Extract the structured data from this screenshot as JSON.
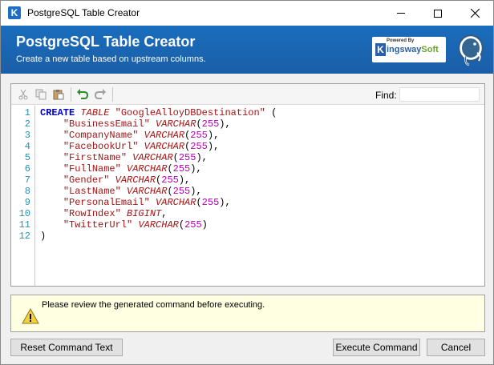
{
  "window": {
    "title": "PostgreSQL Table Creator"
  },
  "banner": {
    "title": "PostgreSQL Table Creator",
    "subtitle": "Create a new table based on upstream columns.",
    "logo_powered": "Powered By",
    "logo_k": "K",
    "logo_name_a": "ingsway",
    "logo_name_b": "Soft"
  },
  "toolbar": {
    "find_label": "Find:",
    "find_value": "",
    "icons": [
      "cut-icon",
      "copy-icon",
      "paste-icon",
      "undo-icon",
      "redo-icon"
    ]
  },
  "editor": {
    "line_numbers": [
      "1",
      "2",
      "3",
      "4",
      "5",
      "6",
      "7",
      "8",
      "9",
      "10",
      "11",
      "12"
    ],
    "create_kw": "CREATE",
    "table_kw": "TABLE",
    "table_name": "\"GoogleAlloyDBDestination\"",
    "open_paren": " (",
    "columns": [
      {
        "name": "\"BusinessEmail\"",
        "type": "VARCHAR",
        "len": "255",
        "trail": "),"
      },
      {
        "name": "\"CompanyName\"",
        "type": "VARCHAR",
        "len": "255",
        "trail": "),"
      },
      {
        "name": "\"FacebookUrl\"",
        "type": "VARCHAR",
        "len": "255",
        "trail": "),"
      },
      {
        "name": "\"FirstName\"",
        "type": "VARCHAR",
        "len": "255",
        "trail": "),"
      },
      {
        "name": "\"FullName\"",
        "type": "VARCHAR",
        "len": "255",
        "trail": "),"
      },
      {
        "name": "\"Gender\"",
        "type": "VARCHAR",
        "len": "255",
        "trail": "),"
      },
      {
        "name": "\"LastName\"",
        "type": "VARCHAR",
        "len": "255",
        "trail": "),"
      },
      {
        "name": "\"PersonalEmail\"",
        "type": "VARCHAR",
        "len": "255",
        "trail": "),"
      },
      {
        "name": "\"RowIndex\"",
        "type": "BIGINT",
        "len": "",
        "trail": ","
      },
      {
        "name": "\"TwitterUrl\"",
        "type": "VARCHAR",
        "len": "255",
        "trail": ")"
      }
    ],
    "close_paren": ")"
  },
  "message": {
    "text": "Please review the generated command before executing."
  },
  "buttons": {
    "reset": "Reset Command Text",
    "execute": "Execute Command",
    "cancel": "Cancel"
  }
}
